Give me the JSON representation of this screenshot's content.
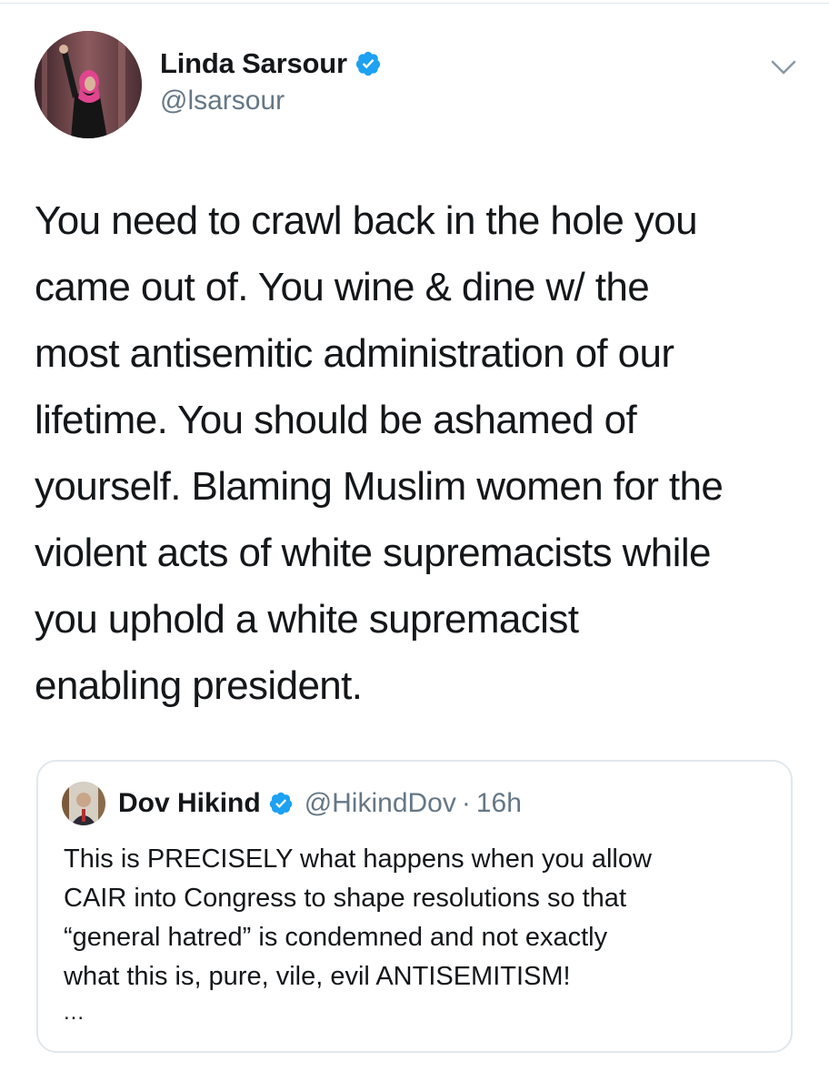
{
  "tweet": {
    "author": {
      "display_name": "Linda Sarsour",
      "handle": "@lsarsour",
      "verified": true
    },
    "menu_icon": "chevron-down-icon",
    "text_lines": [
      "You need to crawl back in the hole you",
      "came out of. You wine & dine w/ the",
      "most antisemitic administration of our",
      "lifetime. You should be ashamed of",
      "yourself. Blaming Muslim women for the",
      "violent acts of white supremacists while",
      "you uphold a white supremacist",
      "enabling president."
    ]
  },
  "quoted_tweet": {
    "display_name": "Dov Hikind",
    "handle": "@HikindDov",
    "separator": "·",
    "time": "16h",
    "verified": true,
    "text_lines": [
      "This is PRECISELY what happens when you allow",
      "CAIR into Congress to shape resolutions so that",
      "“general hatred” is condemned and not exactly",
      "what this is, pure, vile, evil ANTISEMITISM!"
    ],
    "more": "..."
  },
  "colors": {
    "verified_blue": "#1da1f2",
    "secondary_text": "#657786",
    "primary_text": "#14171a",
    "border": "#e1e8ed"
  }
}
